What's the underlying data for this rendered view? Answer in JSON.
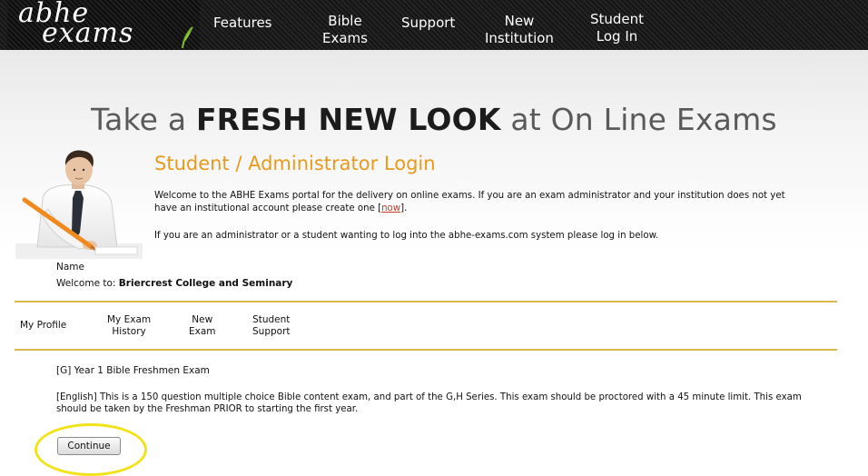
{
  "brand": {
    "logo_line1": "abhe",
    "logo_line2": "exams"
  },
  "nav": {
    "features": "Features",
    "bible_line1": "Bible",
    "bible_line2": "Exams",
    "support": "Support",
    "new_line1": "New",
    "new_line2": "Institution",
    "student_line1": "Student",
    "student_line2": "Log In"
  },
  "hero": {
    "part1": "Take a ",
    "bold": "FRESH NEW LOOK",
    "part2": " at On Line Exams"
  },
  "login": {
    "title": "Student / Administrator Login",
    "welcome_text": "Welcome to the ABHE Exams portal for the delivery on online exams. If you are an exam administrator and your institution does not yet have an institutional account please create one [",
    "now_link": "now",
    "welcome_text_end": "].",
    "admin_text": "If you are an administrator or a student wanting to log into the abhe-exams.com system please log in below."
  },
  "user": {
    "name_label": "Name",
    "welcome_prefix": "Welcome to: ",
    "institution": "Briercrest College and Seminary"
  },
  "subnav": {
    "my_profile": "My Profile",
    "history_line1": "My Exam",
    "history_line2": "History",
    "new_line1": "New",
    "new_line2": "Exam",
    "support_line1": "Student",
    "support_line2": "Support"
  },
  "exam": {
    "title": "[G] Year 1 Bible Freshmen Exam",
    "description": "[English] This is a 150 question multiple choice Bible content exam, and part of the G,H Series. This exam should be proctored with a 45 minute limit. This exam should be taken by the Freshman PRIOR to starting the first year.",
    "continue_label": "Continue"
  },
  "colors": {
    "accent_orange": "#e79a1c",
    "divider_gold": "#d9b94a",
    "highlight_yellow": "#f2e21a",
    "link_red": "#c0392b",
    "header_black": "#1a1a1a"
  },
  "icons": {
    "leaf": "leaf-icon",
    "student": "student-illustration"
  }
}
